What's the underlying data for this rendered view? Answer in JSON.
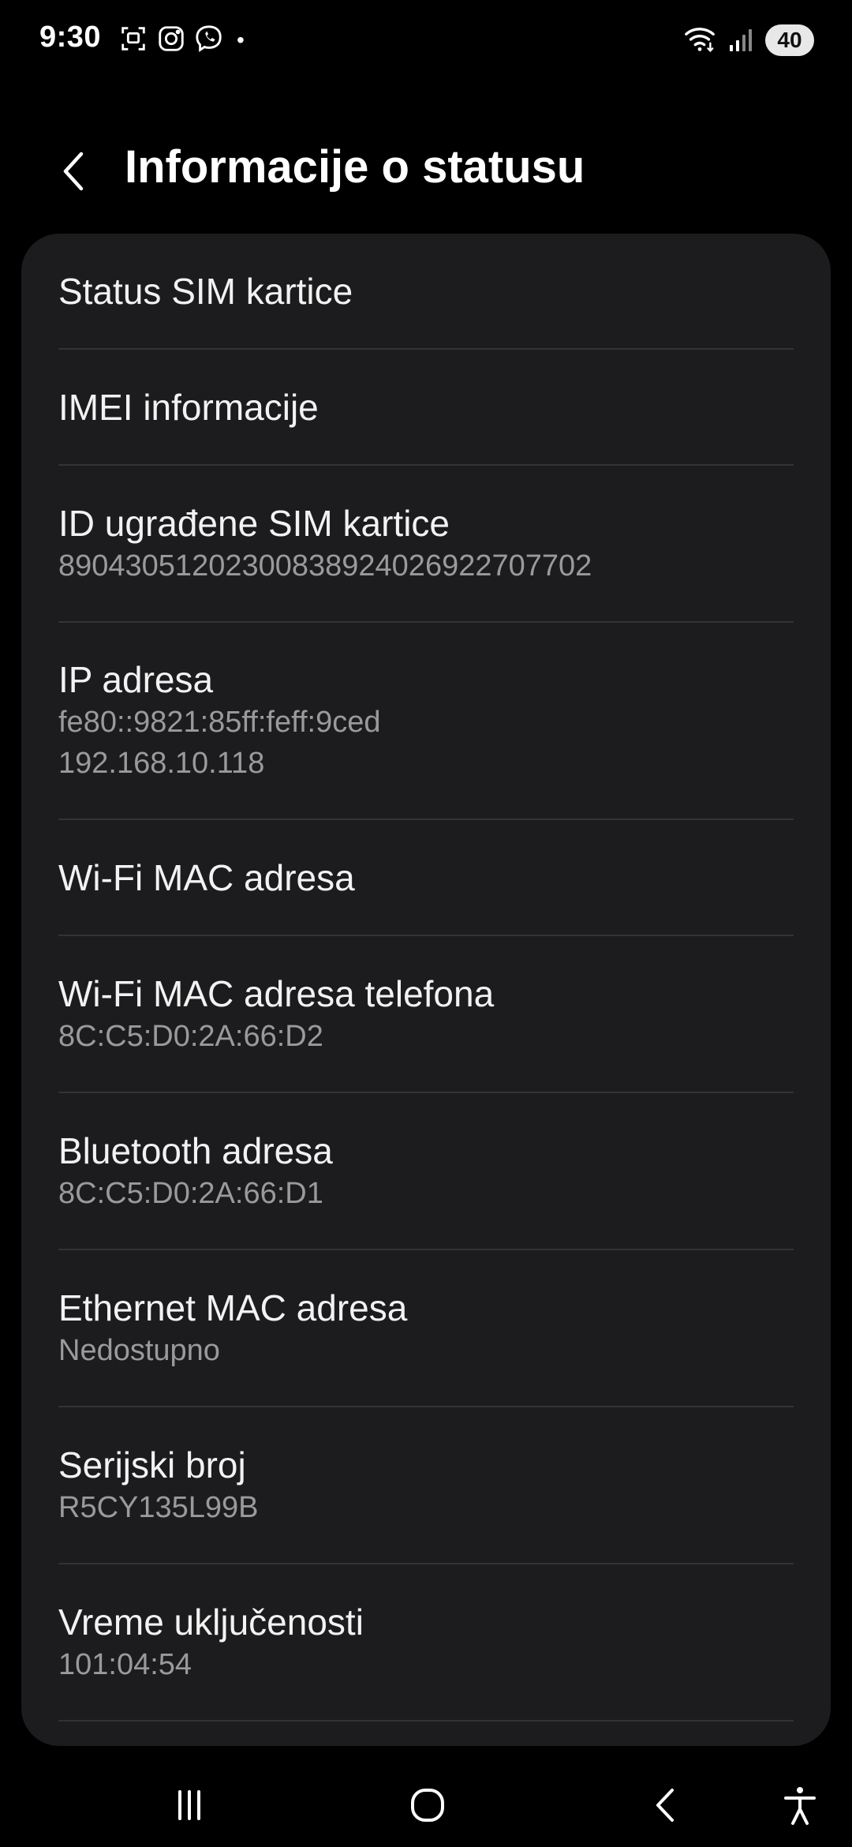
{
  "status_bar": {
    "time": "9:30",
    "notification_icons": [
      "screenshot-icon",
      "instagram-icon",
      "viber-icon"
    ],
    "more_dot": "•",
    "battery": "40",
    "system_icons": [
      "wifi-icon",
      "signal-icon"
    ]
  },
  "header": {
    "title": "Informacije o statusu",
    "back_icon": "chevron-left-icon"
  },
  "items": [
    {
      "title": "Status SIM kartice"
    },
    {
      "title": "IMEI informacije"
    },
    {
      "title": "ID ugrađene SIM kartice",
      "lines": [
        "89043051202300838924026922707702"
      ]
    },
    {
      "title": "IP adresa",
      "lines": [
        "fe80::9821:85ff:feff:9ced",
        "192.168.10.118"
      ]
    },
    {
      "title": "Wi-Fi MAC adresa"
    },
    {
      "title": "Wi-Fi MAC adresa telefona",
      "lines": [
        "8C:C5:D0:2A:66:D2"
      ]
    },
    {
      "title": "Bluetooth adresa",
      "lines": [
        "8C:C5:D0:2A:66:D1"
      ]
    },
    {
      "title": "Ethernet MAC adresa",
      "lines": [
        "Nedostupno"
      ]
    },
    {
      "title": "Serijski broj",
      "lines": [
        "R5CY135L99B"
      ]
    },
    {
      "title": "Vreme uključenosti",
      "lines": [
        "101:04:54"
      ]
    }
  ],
  "nav_bar": {
    "buttons": [
      "recent-apps-icon",
      "home-icon",
      "back-icon",
      "accessibility-icon"
    ]
  },
  "colors": {
    "background": "#000000",
    "card": "#1c1c1e",
    "divider": "#333336",
    "primary_text": "#f2f2f2",
    "secondary_text": "#9a9a9c"
  }
}
